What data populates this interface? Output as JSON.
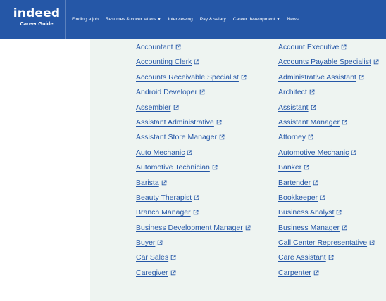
{
  "header": {
    "logo_word": "indeed",
    "logo_sub": "Career Guide",
    "nav": [
      {
        "label": "Finding a job",
        "has_dropdown": false
      },
      {
        "label": "Resumes & cover letters",
        "has_dropdown": true
      },
      {
        "label": "Interviewing",
        "has_dropdown": false
      },
      {
        "label": "Pay & salary",
        "has_dropdown": false
      },
      {
        "label": "Career development",
        "has_dropdown": true
      },
      {
        "label": "News",
        "has_dropdown": false
      }
    ],
    "colors": {
      "nav_bg": "#2557a7",
      "link": "#2557a7",
      "panel_bg": "#eef4f1"
    }
  },
  "jobs": {
    "left": [
      "Accountant",
      "Accounting Clerk",
      "Accounts Receivable Specialist",
      "Android Developer",
      "Assembler",
      "Assistant Administrative",
      "Assistant Store Manager",
      "Auto Mechanic",
      "Automotive Technician",
      "Barista",
      "Beauty Therapist",
      "Branch Manager",
      "Business Development Manager",
      "Buyer",
      "Car Sales",
      "Caregiver"
    ],
    "right": [
      "Account Executive",
      "Accounts Payable Specialist",
      "Administrative Assistant",
      "Architect",
      "Assistant",
      "Assistant Manager",
      "Attorney",
      "Automotive Mechanic",
      "Banker",
      "Bartender",
      "Bookkeeper",
      "Business Analyst",
      "Business Manager",
      "Call Center Representative",
      "Care Assistant",
      "Carpenter"
    ],
    "link_icon": "external-link-icon"
  }
}
